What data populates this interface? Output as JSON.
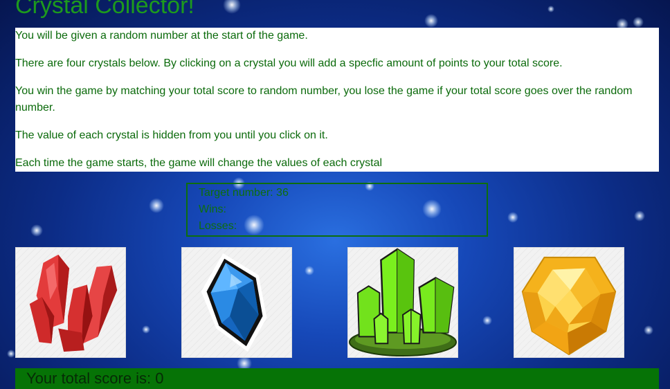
{
  "title": "Crystal Collector!",
  "instructions": [
    "You will be given a random number at the start of the game.",
    "There are four crystals below. By clicking on a crystal you will add a specfic amount of points to your total score.",
    "You win the game by matching your total score to random number, you lose the game if your total score goes over the random number.",
    "The value of each crystal is hidden from you until you click on it.",
    "Each time the game starts, the game will change the values of each crystal"
  ],
  "stats": {
    "target_label": "Target number: 36",
    "wins_label": "Wins:",
    "losses_label": "Losses:"
  },
  "crystals": [
    {
      "name": "red-crystal-icon",
      "color": "#d42a2a"
    },
    {
      "name": "blue-crystal-icon",
      "color": "#1f7fd8"
    },
    {
      "name": "green-crystal-icon",
      "color": "#6ee619"
    },
    {
      "name": "yellow-crystal-icon",
      "color": "#f5b41e"
    }
  ],
  "total_score": {
    "label": "Your total score is: 0"
  },
  "colors": {
    "title": "#1d9a1d",
    "text": "#0b6a0b",
    "total_bar": "#067306"
  }
}
